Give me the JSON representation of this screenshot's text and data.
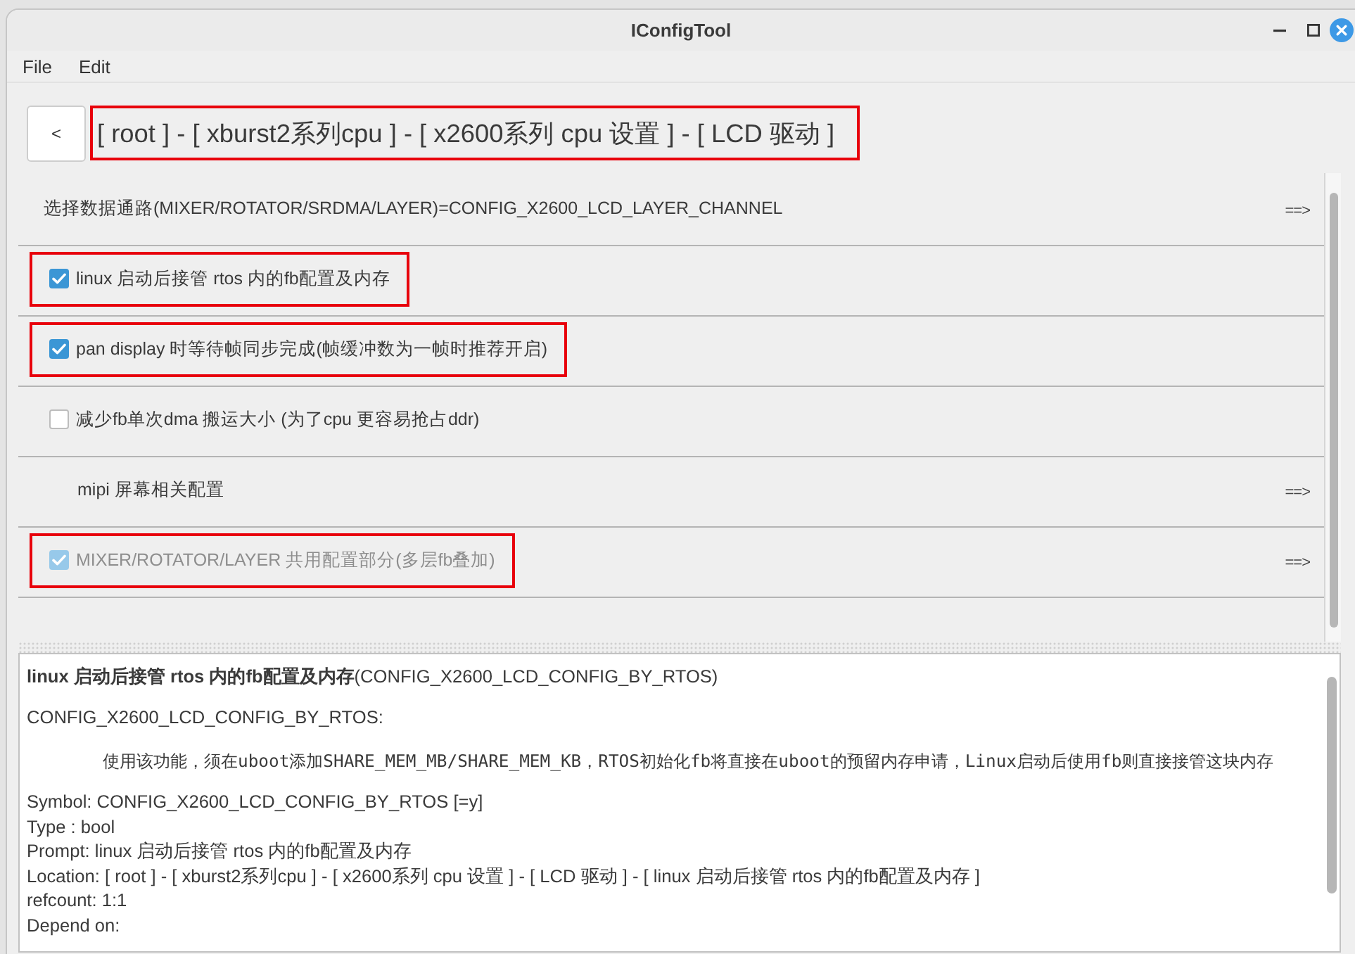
{
  "window": {
    "title": "IConfigTool"
  },
  "menu_bar": [
    {
      "label": "File"
    },
    {
      "label": "Edit"
    }
  ],
  "breadcrumb": {
    "back_button": "<",
    "path": "[ root ] - [ xburst2系列cpu ] - [ x2600系列 cpu 设置 ] - [ LCD 驱动 ]",
    "highlighted": true
  },
  "items": [
    {
      "kind": "choice",
      "label": "选择数据通路(MIXER/ROTATOR/SRDMA/LAYER)=CONFIG_X2600_LCD_LAYER_CHANNEL",
      "arrow": "==>",
      "highlighted": false
    },
    {
      "kind": "checkbox",
      "label": "linux 启动后接管 rtos 内的fb配置及内存",
      "checked": true,
      "disabled": false,
      "highlighted": true
    },
    {
      "kind": "checkbox",
      "label": "pan display 时等待帧同步完成(帧缓冲数为一帧时推荐开启)",
      "checked": true,
      "disabled": false,
      "highlighted": true
    },
    {
      "kind": "checkbox",
      "label": "减少fb单次dma 搬运大小 (为了cpu 更容易抢占ddr)",
      "checked": false,
      "disabled": false,
      "highlighted": false
    },
    {
      "kind": "menu",
      "label": "mipi 屏幕相关配置",
      "arrow": "==>",
      "highlighted": false
    },
    {
      "kind": "checkbox",
      "label": "MIXER/ROTATOR/LAYER 共用配置部分(多层fb叠加)",
      "checked": true,
      "disabled": true,
      "arrow": "==>",
      "highlighted": true
    }
  ],
  "details": {
    "heading": "**linux 启动后接管 rtos 内的fb配置及内存**(CONFIG_X2600_LCD_CONFIG_BY_RTOS)",
    "symbol": "CONFIG_X2600_LCD_CONFIG_BY_RTOS:",
    "help": "使用该功能，须在uboot添加SHARE_MEM_MB/SHARE_MEM_KB，RTOS初始化fb将直接在uboot的预留内存申请，Linux启动后使用fb则直接接管这块内存",
    "lines": [
      "Symbol: CONFIG_X2600_LCD_CONFIG_BY_RTOS [=y]",
      "Type : bool",
      "Prompt: linux 启动后接管 rtos 内的fb配置及内存",
      "Location: [ root ] - [ xburst2系列cpu ] - [ x2600系列 cpu 设置 ] - [ LCD 驱动 ] - [ linux 启动后接管 rtos 内的fb配置及内存 ]",
      "refcount: 1:1",
      "Depend on:"
    ]
  }
}
